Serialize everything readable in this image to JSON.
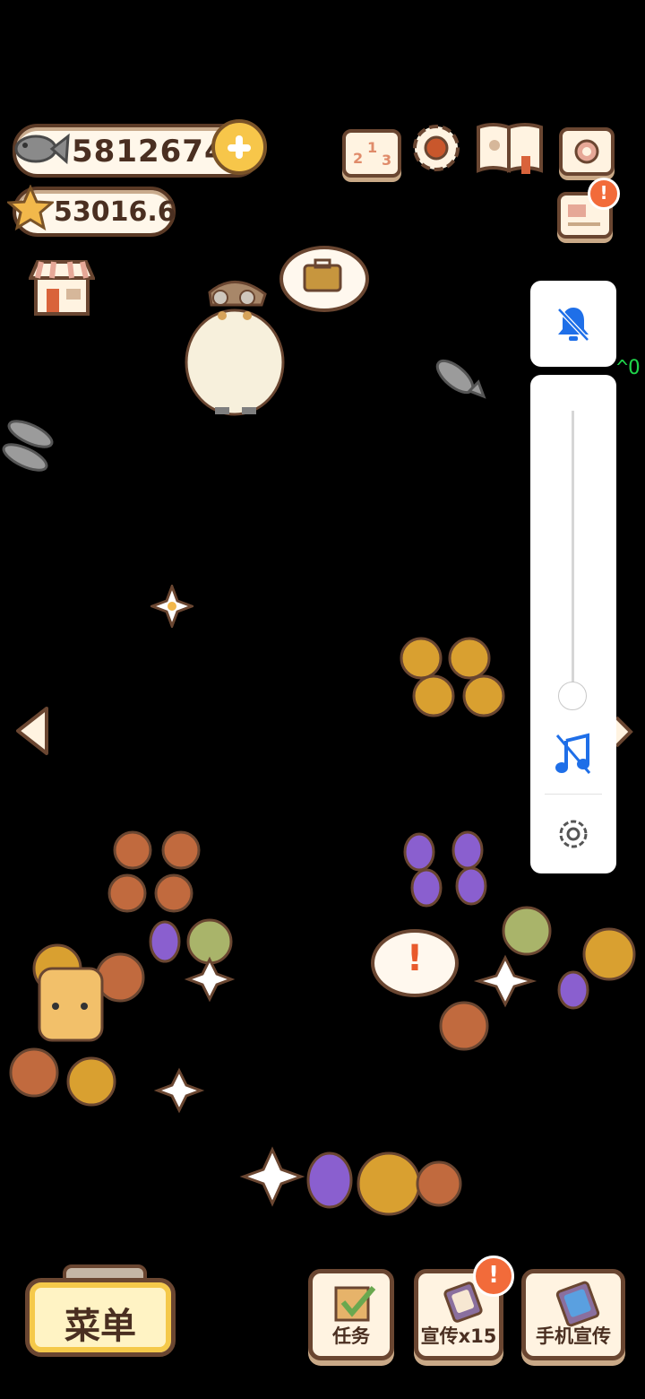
{
  "currency": {
    "fish_value": "5812674",
    "star_value": "53016.6"
  },
  "icons": {
    "fish": "fish-icon",
    "star": "star-icon",
    "plus": "plus-icon",
    "ranking": "ranking-podium-icon",
    "settings": "gear-icon",
    "book": "book-icon",
    "camera": "camera-icon",
    "mail": "mail-icon",
    "shop": "shop-icon"
  },
  "bubbles": {
    "travel": "suitcase-icon",
    "alert_mark": "!"
  },
  "side_panel": {
    "bell_icon": "bell-off-icon",
    "music_icon": "music-off-icon",
    "settings_icon": "gear-icon",
    "volume_level": 0.0
  },
  "edge_text": "^O",
  "bottom_bar": {
    "menu_label": "菜单",
    "tasks_label": "任务",
    "promote_label": "宣传x15",
    "phone_promote_label": "手机宣传",
    "promote_badge": "!"
  },
  "colors": {
    "ui_brown": "#6a4631",
    "cream": "#fff3e1",
    "accent_yellow": "#f5c94a",
    "badge_orange": "#f26b3a",
    "system_blue": "#1f6fe8"
  }
}
